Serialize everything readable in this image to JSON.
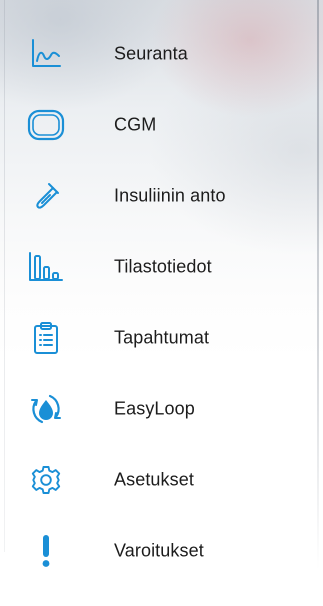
{
  "colors": {
    "accent": "#1a8fd6",
    "text": "#1c1c1c"
  },
  "menu": {
    "items": [
      {
        "label": "Seuranta",
        "icon": "trend-chart-icon"
      },
      {
        "label": "CGM",
        "icon": "cgm-sensor-icon"
      },
      {
        "label": "Insuliinin anto",
        "icon": "insulin-pump-icon"
      },
      {
        "label": "Tilastotiedot",
        "icon": "bar-chart-icon"
      },
      {
        "label": "Tapahtumat",
        "icon": "clipboard-list-icon"
      },
      {
        "label": "EasyLoop",
        "icon": "drop-cycle-icon"
      },
      {
        "label": "Asetukset",
        "icon": "gear-icon"
      },
      {
        "label": "Varoitukset",
        "icon": "exclamation-icon"
      }
    ]
  }
}
